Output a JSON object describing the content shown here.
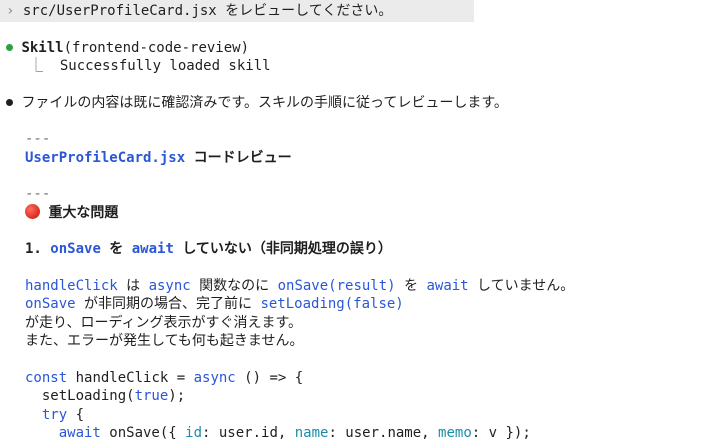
{
  "prompt": {
    "chevron": "›",
    "text": "src/UserProfileCard.jsx をレビューしてください。"
  },
  "skill": {
    "name": "Skill",
    "arg": "(frontend-code-review)",
    "branch": "⎿",
    "status": "Successfully loaded skill"
  },
  "message": "ファイルの内容は既に確認済みです。スキルの手順に従ってレビューします。",
  "review": {
    "separator": "---",
    "title_file": "UserProfileCard.jsx",
    "title_suffix": " コードレビュー",
    "section_heading": "重大な問題",
    "issue1": {
      "number": "1.",
      "code1": "onSave",
      "text1": " を ",
      "code2": "await",
      "text2": " していない（非同期処理の誤り）"
    },
    "para": {
      "l1_c1": "handleClick",
      "l1_t1": " は ",
      "l1_c2": "async",
      "l1_t2": " 関数なのに ",
      "l1_c3": "onSave(result)",
      "l1_t3": " を ",
      "l1_c4": "await",
      "l1_t4": " していません。",
      "l2_c1": "onSave",
      "l2_t1": " が非同期の場合、完了前に ",
      "l2_c2": "setLoading(false)",
      "l3": "が走り、ローディング表示がすぐ消えます。",
      "l4": "また、エラーが発生しても何も起きません。"
    },
    "code": {
      "c1_kw": "const",
      "c1_mid": " handleClick = ",
      "c1_kw2": "async",
      "c1_end": " () => {",
      "c2_fn": "  setLoading(",
      "c2_kw": "true",
      "c2_end": ");",
      "c3_kw": "  try",
      "c3_end": " {",
      "c4_kw": "    await",
      "c4_a": " onSave({ ",
      "c4_k1": "id",
      "c4_b": ": user.id, ",
      "c4_k2": "name",
      "c4_c": ": user.name, ",
      "c4_k3": "memo",
      "c4_d": ": v });"
    }
  }
}
